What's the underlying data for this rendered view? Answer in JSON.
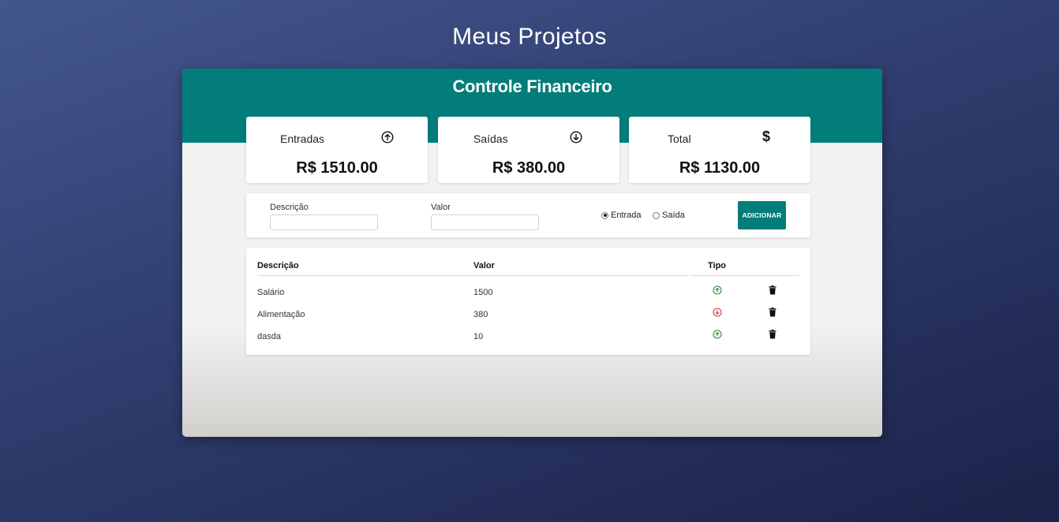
{
  "page": {
    "title": "Meus Projetos"
  },
  "nav": {
    "prev": "«",
    "next": "»"
  },
  "app": {
    "title": "Controle Financeiro"
  },
  "summary": {
    "entradas": {
      "label": "Entradas",
      "amount": "R$ 1510.00",
      "icon": "arrow-up-circle-icon"
    },
    "saidas": {
      "label": "Saídas",
      "amount": "R$ 380.00",
      "icon": "arrow-down-circle-icon"
    },
    "total": {
      "label": "Total",
      "amount": "R$ 1130.00",
      "icon": "dollar-icon"
    }
  },
  "form": {
    "descricao_label": "Descrição",
    "descricao_value": "",
    "valor_label": "Valor",
    "valor_value": "",
    "radio_entrada": "Entrada",
    "radio_saida": "Saída",
    "selected_type": "Entrada",
    "add_button": "ADICIONAR"
  },
  "table": {
    "headers": {
      "descricao": "Descrição",
      "valor": "Valor",
      "tipo": "Tipo"
    },
    "rows": [
      {
        "descricao": "Salário",
        "valor": "1500",
        "tipo": "entrada"
      },
      {
        "descricao": "Alimentação",
        "valor": "380",
        "tipo": "saida"
      },
      {
        "descricao": "dasda",
        "valor": "10",
        "tipo": "entrada"
      }
    ]
  },
  "colors": {
    "primary": "#027d7a",
    "income": "#2e8b3a",
    "expense": "#d9363e"
  }
}
